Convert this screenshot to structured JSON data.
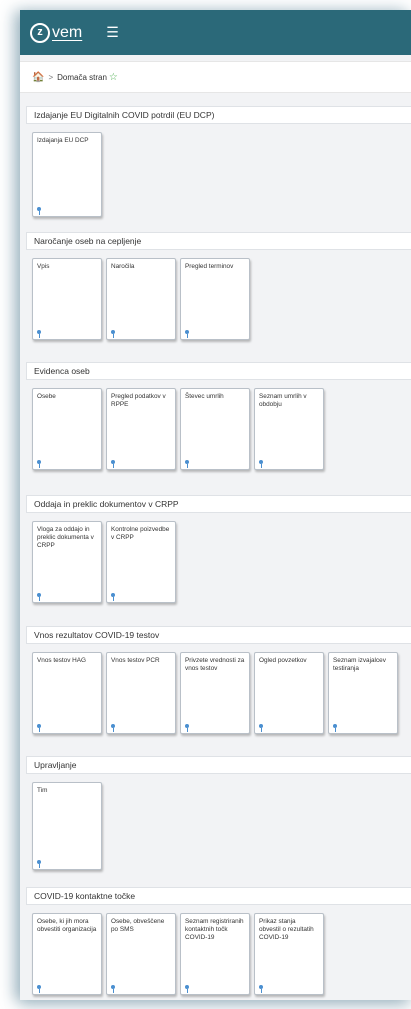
{
  "header": {
    "logo_mark": "z",
    "logo_text": "vem",
    "menu_icon": "hamburger-icon",
    "bar_color": "#2b6979"
  },
  "breadcrumb": {
    "home_icon": "home-icon",
    "separator": ">",
    "current": "Domača stran",
    "favorite_icon": "star-icon"
  },
  "sections": [
    {
      "title": "Izdajanje EU Digitalnih COVID potrdil (EU DCP)",
      "tiles": [
        "Izdajanja EU DCP"
      ]
    },
    {
      "title": "Naročanje oseb na cepljenje",
      "tiles": [
        "Vpis",
        "Naročila",
        "Pregled terminov"
      ]
    },
    {
      "title": "Evidenca oseb",
      "tiles": [
        "Osebe",
        "Pregled podatkov v RPPE",
        "Števec umrlih",
        "Seznam umrlih v obdobju"
      ]
    },
    {
      "title": "Oddaja in preklic dokumentov v CRPP",
      "tiles": [
        "Vloga za oddajo in preklic dokumenta v CRPP",
        "Kontrolne poizvedbe v CRPP"
      ]
    },
    {
      "title": "Vnos rezultatov COVID-19 testov",
      "tiles": [
        "Vnos testov HAG",
        "Vnos testov PCR",
        "Privzete vrednosti za vnos testov",
        "Ogled povzetkov",
        "Seznam izvajalcev testiranja"
      ]
    },
    {
      "title": "Upravljanje",
      "tiles": [
        "Tim"
      ]
    },
    {
      "title": "COVID-19 kontaktne točke",
      "tiles": [
        "Osebe, ki jih mora obvestiti organizacija",
        "Osebe, obveščene po SMS",
        "Seznam registriranih kontaktnih točk COVID-19",
        "Prikaz stanja obvestil o rezultatih COVID-19"
      ]
    }
  ]
}
